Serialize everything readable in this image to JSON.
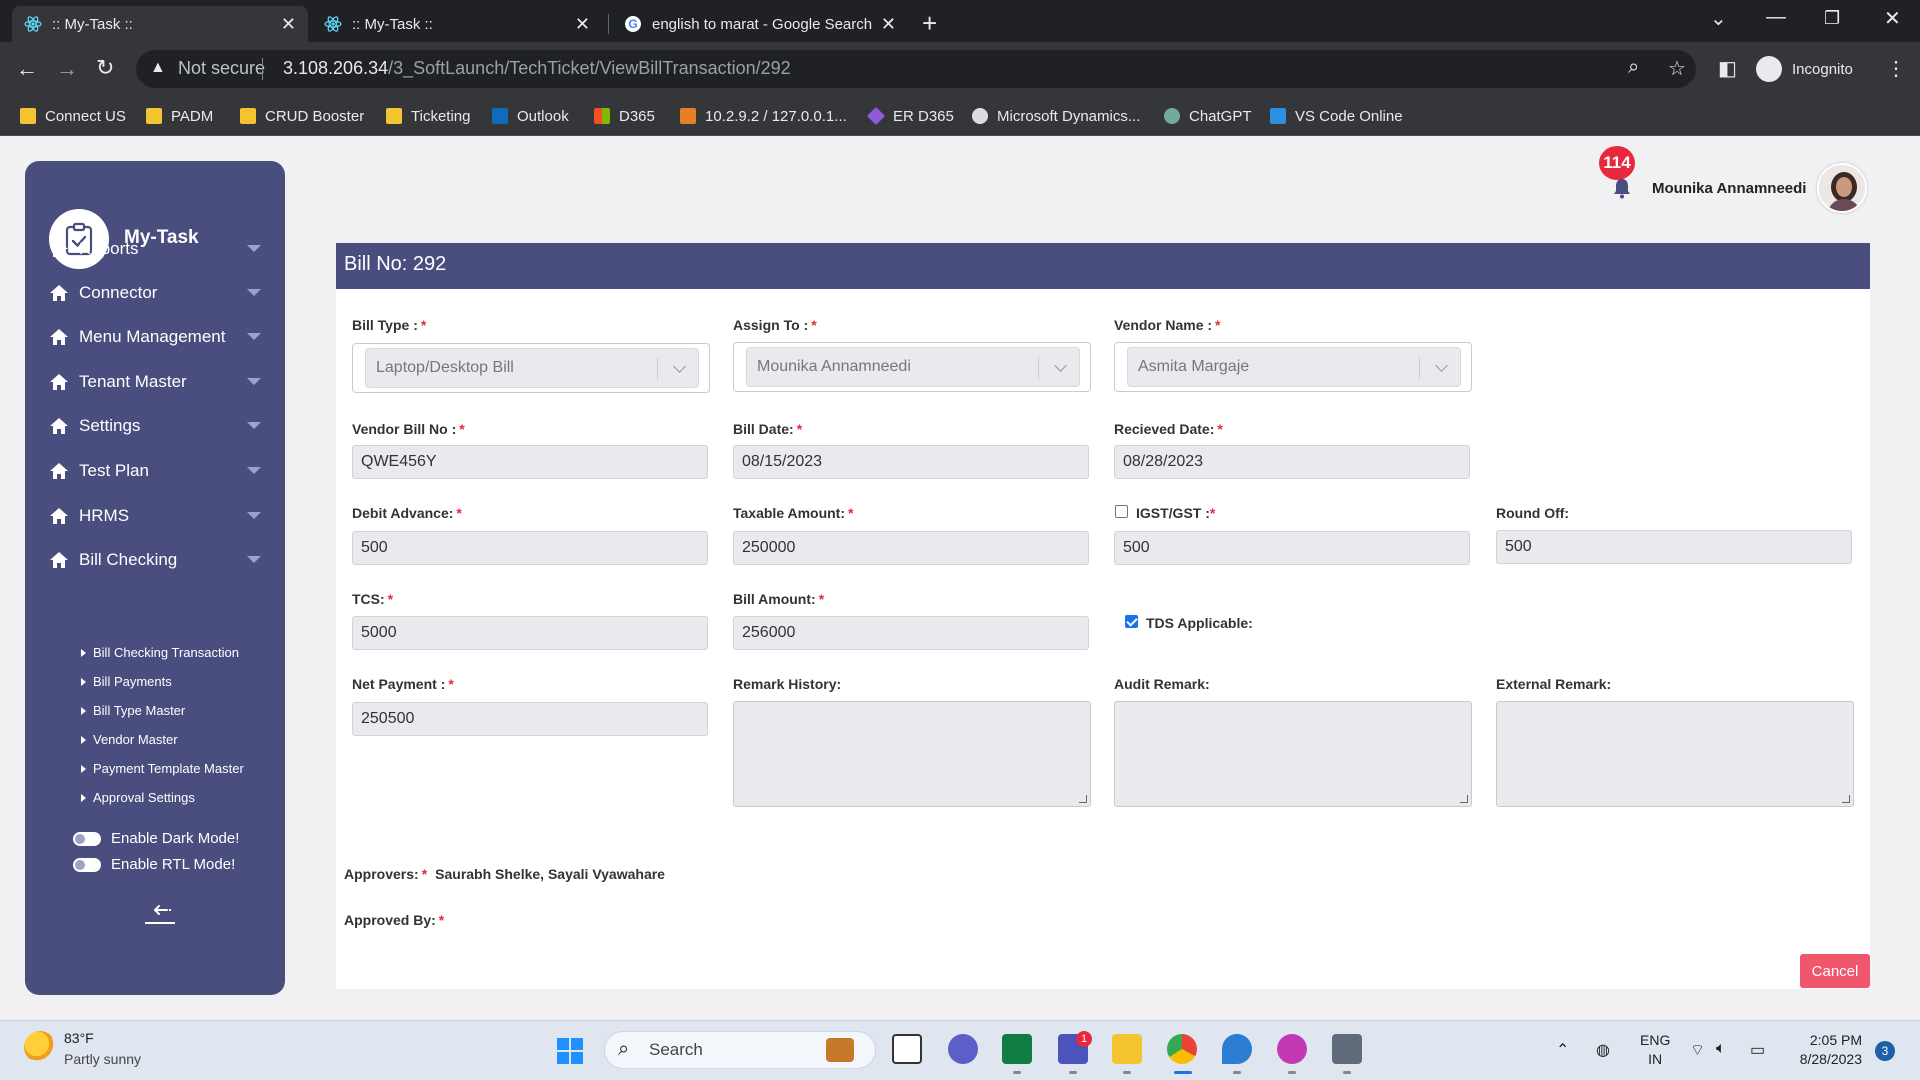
{
  "browser": {
    "tabs": [
      {
        "title": ":: My-Task ::",
        "active": true
      },
      {
        "title": ":: My-Task ::",
        "active": false
      },
      {
        "title": "english to marat - Google Search",
        "active": false
      }
    ],
    "address": {
      "security": "Not secure",
      "host": "3.108.206.34",
      "path": "/3_SoftLaunch/TechTicket/ViewBillTransaction/292"
    },
    "profile": "Incognito",
    "bookmarks": [
      {
        "label": "Connect US",
        "color": "#f4c430"
      },
      {
        "label": "PADM",
        "color": "#f4c430"
      },
      {
        "label": "CRUD Booster",
        "color": "#f4c430"
      },
      {
        "label": "Ticketing",
        "color": "#f4c430"
      },
      {
        "label": "Outlook",
        "color": "#0f6cbd"
      },
      {
        "label": "D365",
        "color": "#f25022"
      },
      {
        "label": "10.2.9.2 / 127.0.0.1...",
        "color": "#e67e22"
      },
      {
        "label": "ER D365",
        "color": "#8e5bd6"
      },
      {
        "label": "Microsoft Dynamics...",
        "color": "#dadce0"
      },
      {
        "label": "ChatGPT",
        "color": "#74aa9c"
      },
      {
        "label": "VS Code Online",
        "color": "#2c8fe0"
      }
    ]
  },
  "sidebar": {
    "app_name": "My-Task",
    "menu": [
      {
        "label": "Reports"
      },
      {
        "label": "Connector"
      },
      {
        "label": "Menu Management"
      },
      {
        "label": "Tenant Master"
      },
      {
        "label": "Settings"
      },
      {
        "label": "Test Plan"
      },
      {
        "label": "HRMS"
      },
      {
        "label": "Bill Checking"
      }
    ],
    "submenu": [
      {
        "label": "Bill Checking Transaction"
      },
      {
        "label": "Bill Payments"
      },
      {
        "label": "Bill Type Master"
      },
      {
        "label": "Vendor Master"
      },
      {
        "label": "Payment Template Master"
      },
      {
        "label": "Approval Settings"
      }
    ],
    "toggles": [
      {
        "label": "Enable Dark Mode!"
      },
      {
        "label": "Enable RTL Mode!"
      }
    ]
  },
  "header": {
    "notification_count": "114",
    "user_name": "Mounika Annamneedi"
  },
  "bill": {
    "title": "Bill No: 292",
    "required_mark": "*",
    "bill_type": {
      "label": "Bill Type :",
      "value": "Laptop/Desktop Bill"
    },
    "assign_to": {
      "label": "Assign To :",
      "value": "Mounika Annamneedi"
    },
    "vendor_name": {
      "label": "Vendor Name :",
      "value": "Asmita Margaje"
    },
    "vendor_bill_no": {
      "label": "Vendor Bill No :",
      "value": "QWE456Y"
    },
    "bill_date": {
      "label": "Bill Date:",
      "value": "08/15/2023"
    },
    "received_date": {
      "label": "Recieved Date:",
      "value": "08/28/2023"
    },
    "debit_advance": {
      "label": "Debit Advance:",
      "value": "500"
    },
    "taxable_amount": {
      "label": "Taxable Amount:",
      "value": "250000"
    },
    "igst_gst": {
      "label": "IGST/GST :",
      "value": "500",
      "checked": false
    },
    "round_off": {
      "label": "Round Off:",
      "value": "500"
    },
    "tcs": {
      "label": "TCS:",
      "value": "5000"
    },
    "bill_amount": {
      "label": "Bill Amount:",
      "value": "256000"
    },
    "tds_applicable": {
      "label": "TDS Applicable:",
      "checked": true
    },
    "net_payment": {
      "label": "Net Payment :",
      "value": "250500"
    },
    "remark_history": {
      "label": "Remark History:"
    },
    "audit_remark": {
      "label": "Audit Remark:"
    },
    "external_remark": {
      "label": "External Remark:"
    },
    "approvers": {
      "label": "Approvers:",
      "value": "Saurabh Shelke, Sayali Vyawahare"
    },
    "approved_by": {
      "label": "Approved By:"
    },
    "cancel_label": "Cancel"
  },
  "taskbar": {
    "weather_temp": "83°F",
    "weather_desc": "Partly sunny",
    "search_label": "Search",
    "teams_badge": "1",
    "lang_top": "ENG",
    "lang_bottom": "IN",
    "time": "2:05 PM",
    "date": "8/28/2023",
    "notification_count": "3"
  }
}
